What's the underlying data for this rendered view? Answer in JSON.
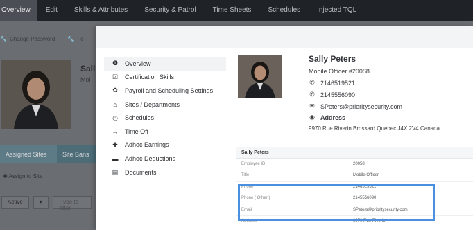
{
  "topnav": {
    "tabs": [
      "Overview",
      "Edit",
      "Skills & Attributes",
      "Security & Patrol",
      "Time Sheets",
      "Schedules",
      "Injected TQL"
    ]
  },
  "background": {
    "actions": [
      "Change Password",
      "Fo"
    ],
    "name_partial": "Sall",
    "subtitle_partial": "Mol",
    "tabs": [
      "Assigned Sites",
      "Site Bans"
    ],
    "assign_link": "Assign to Site",
    "filter_button": "Active",
    "filter_caret": "▾",
    "filter_placeholder": "Type to filter"
  },
  "sidebar": {
    "items": [
      {
        "label": "Overview",
        "icon": "info-circle-icon",
        "glyph": "❶"
      },
      {
        "label": "Certification Skills",
        "icon": "checkbox-icon",
        "glyph": "☑"
      },
      {
        "label": "Payroll and Scheduling Settings",
        "icon": "gear-icon",
        "glyph": "✿"
      },
      {
        "label": "Sites / Departments",
        "icon": "house-icon",
        "glyph": "⌂"
      },
      {
        "label": "Schedules",
        "icon": "clock-icon",
        "glyph": "◷"
      },
      {
        "label": "Time Off",
        "icon": "arrows-icon",
        "glyph": "↔"
      },
      {
        "label": "Adhoc Earnings",
        "icon": "plus-icon",
        "glyph": "✚"
      },
      {
        "label": "Adhoc Deductions",
        "icon": "minus-icon",
        "glyph": "▬"
      },
      {
        "label": "Documents",
        "icon": "document-icon",
        "glyph": "▤"
      }
    ]
  },
  "profile": {
    "name": "Sally Peters",
    "title": "Mobile Officer #20058",
    "phone1": "2146519521",
    "phone2": "2145556090",
    "email": "SPeters@prioritysecurity.com",
    "address_label": "Address",
    "address": "9970 Rue Riverin Brossard Quebec J4X 2V4 Canada"
  },
  "details": {
    "title": "Sally Peters",
    "rows": [
      {
        "k": "Employee ID",
        "v": "20058"
      },
      {
        "k": "Title",
        "v": "Mobile Officer"
      },
      {
        "k": "Phone",
        "v": "2146519521"
      },
      {
        "k": "Phone ( Other )",
        "v": "2145556090"
      },
      {
        "k": "Email",
        "v": "SPeters@prioritysecurity.com"
      },
      {
        "k": "Address",
        "v": "9970 Rue Riverin"
      }
    ]
  },
  "colors": {
    "highlight": "#4a8fe0",
    "nav_bg": "#1f2227"
  }
}
